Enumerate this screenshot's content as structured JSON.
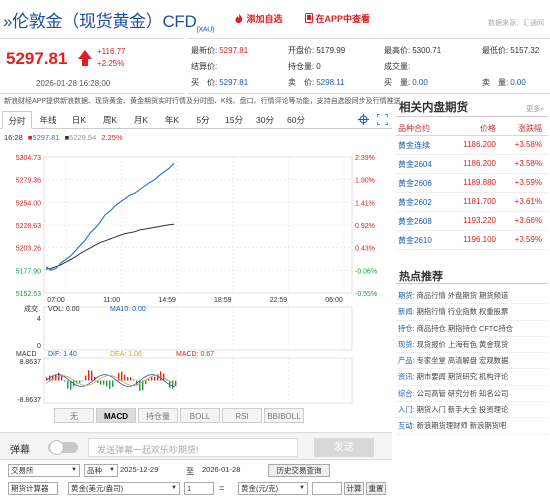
{
  "header": {
    "title": "»伦敦金（现货黄金）CFD",
    "title_sub": "(XAU)",
    "add_watch": "添加自选",
    "app_view": "在APP中查看",
    "data_source": "数据来源：汇通网"
  },
  "quote": {
    "price": "5297.81",
    "change": "+116.77",
    "change_pct": "+2.25%",
    "time": "2026-01-28 16:28:00"
  },
  "quote_table": [
    {
      "label": "最新价:",
      "value": "5297.81",
      "color": "red"
    },
    {
      "label": "开盘价:",
      "value": "5179.99",
      "color": "black"
    },
    {
      "label": "最高价:",
      "value": "5300.71",
      "color": "black"
    },
    {
      "label": "最低价:",
      "value": "5157.32",
      "color": "black"
    },
    {
      "label": "结算价:",
      "value": "",
      "color": "black"
    },
    {
      "label": "持仓量:",
      "value": "0",
      "color": "black"
    },
    {
      "label": "成交量:",
      "value": "",
      "color": "black"
    },
    {
      "label": "",
      "value": "",
      "color": "black"
    },
    {
      "label": "买　价:",
      "value": "5297.81",
      "color": "blue"
    },
    {
      "label": "卖　价:",
      "value": "5298.11",
      "color": "blue"
    },
    {
      "label": "买　量:",
      "value": "0.00",
      "color": "blue"
    },
    {
      "label": "卖　量:",
      "value": "0.00",
      "color": "blue"
    }
  ],
  "info_bar": "新浪财经APP提供新浪数据、现货黄金、黄金期货实时行情及分时图、K线、盘口、行情评论等功能，支持自选股同步及行情推送",
  "tabs": [
    "分时",
    "年线",
    "日K",
    "周K",
    "月K",
    "年K",
    "5分",
    "15分",
    "30分",
    "60分"
  ],
  "legend": {
    "time": "16:28",
    "price": "5297.81",
    "avg": "5229.54",
    "pct": "2.25%"
  },
  "y_labels_left": [
    "5304.73",
    "5279.36",
    "5254.00",
    "5228.63",
    "5203.26",
    "5177.90",
    "5152.53"
  ],
  "y_labels_right": [
    "2.39%",
    "1.90%",
    "1.41%",
    "0.92%",
    "0.43%",
    "-0.06%",
    "-0.55%"
  ],
  "x_labels": [
    "07:00",
    "11:00",
    "14:59",
    "18:59",
    "22:59",
    "06:00"
  ],
  "volume": {
    "title": "成交",
    "vol": "VOL: 0.00",
    "ma": "MA10: 0.00",
    "max": "4",
    "min": "0"
  },
  "macd": {
    "title": "MACD",
    "dif": "DIF: 1.40",
    "dea": "DEA: 1.06",
    "macd": "MACD: 0.67",
    "max": "8.8637",
    "min": "-8.8637"
  },
  "bottom_tabs": [
    "无",
    "MACD",
    "持仓量",
    "BOLL",
    "RSI",
    "BBIBOLL"
  ],
  "barrage": {
    "label": "弹幕",
    "placeholder": "发送弹幕一起欢乐吵期货!",
    "send": "发送"
  },
  "form": {
    "exchange": "交易所",
    "variety": "品种",
    "date_from": "2025-12-29",
    "to": "至",
    "date_to": "2026-01-28",
    "query": "历史交易查询",
    "calc": "期货计算器",
    "unit1": "黄金(美元/盎司)",
    "amount1": "1",
    "eq": "=",
    "unit2": "黄金(元/克)",
    "calc_btn": "计算",
    "reset_btn": "重置"
  },
  "related": {
    "title": "相关内盘期货",
    "more": "更多»",
    "headers": [
      "品种合约",
      "价格",
      "涨跌幅"
    ],
    "rows": [
      {
        "name": "黄金连续",
        "price": "1186.200",
        "chg": "+3.58%"
      },
      {
        "name": "黄金2604",
        "price": "1186.200",
        "chg": "+3.58%"
      },
      {
        "name": "黄金2606",
        "price": "1189.880",
        "chg": "+3.59%"
      },
      {
        "name": "黄金2602",
        "price": "1181.700",
        "chg": "+3.61%"
      },
      {
        "name": "黄金2608",
        "price": "1193.220",
        "chg": "+3.66%"
      },
      {
        "name": "黄金2610",
        "price": "1196.100",
        "chg": "+3.59%"
      }
    ]
  },
  "hot": {
    "title": "热点推荐",
    "rows": [
      {
        "cat": "期货:",
        "text": "商品行情 外盘期货 期货频道"
      },
      {
        "cat": "新闻:",
        "text": "期指行情 行业指数 权重股票"
      },
      {
        "cat": "持仓:",
        "text": "商品持仓 期指持仓 CFTC持仓"
      },
      {
        "cat": "现货:",
        "text": "现货报价 上海有色 黄金现货"
      },
      {
        "cat": "产品:",
        "text": "专家坐堂 高清解盘 宏观数据"
      },
      {
        "cat": "资讯:",
        "text": "期市要闻 期货研究 机构评论"
      },
      {
        "cat": "综合:",
        "text": "公司高管 研究分析 知名公司"
      },
      {
        "cat": "入门:",
        "text": "期货入门 新手大全 投资理论"
      },
      {
        "cat": "互动:",
        "text": "新浪期货理财师 新浪期货吧"
      }
    ]
  },
  "chart_data": {
    "type": "line",
    "series": [
      {
        "values": [
          5182,
          5178,
          5180,
          5186,
          5190,
          5194,
          5200,
          5206,
          5212,
          5220,
          5225,
          5232,
          5240,
          5244,
          5250,
          5254,
          5258,
          5262,
          5264,
          5268,
          5272,
          5276,
          5279,
          5284,
          5288,
          5292,
          5297.81
        ]
      },
      {
        "values": [
          5179,
          5180,
          5182,
          5184,
          5187,
          5190,
          5193,
          5197,
          5200,
          5203,
          5206,
          5209,
          5211,
          5213,
          5215,
          5217,
          5219,
          5220,
          5221,
          5223,
          5224,
          5225,
          5226,
          5227,
          5228,
          5229,
          5229.54
        ]
      }
    ],
    "ylim": [
      5152.53,
      5304.73
    ],
    "colors": {
      "price": "#2b7ad8",
      "avg": "#333333"
    }
  }
}
